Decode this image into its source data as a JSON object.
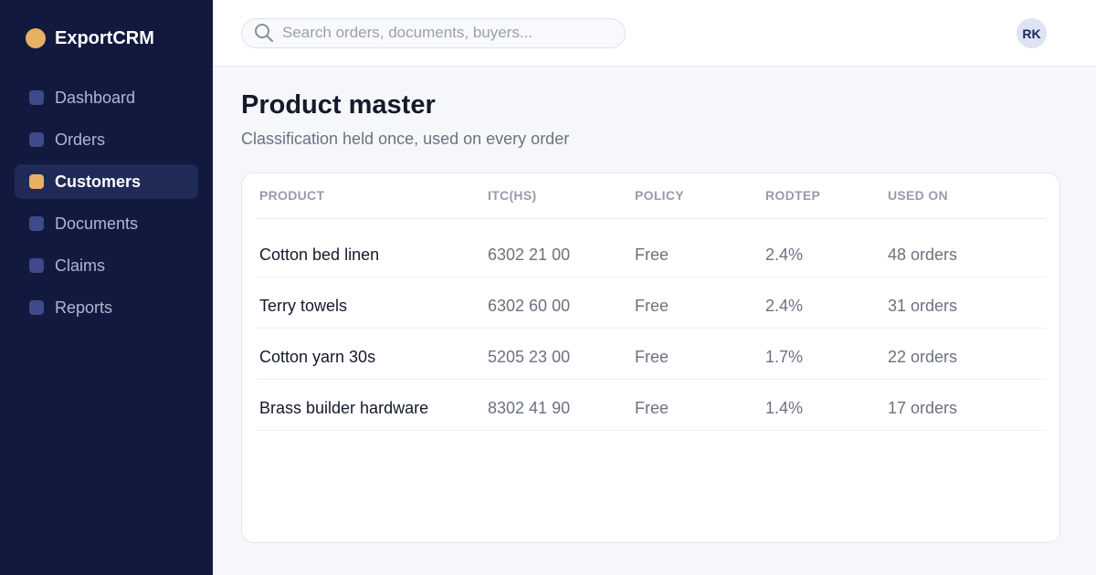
{
  "brand": {
    "name": "ExportCRM"
  },
  "sidebar": {
    "items": [
      {
        "label": "Dashboard",
        "active": false
      },
      {
        "label": "Orders",
        "active": false
      },
      {
        "label": "Customers",
        "active": true
      },
      {
        "label": "Documents",
        "active": false
      },
      {
        "label": "Claims",
        "active": false
      },
      {
        "label": "Reports",
        "active": false
      }
    ]
  },
  "topbar": {
    "search_placeholder": "Search orders, documents, buyers...",
    "avatar_initials": "RK"
  },
  "page": {
    "title": "Product master",
    "subtitle": "Classification held once, used on every order"
  },
  "table": {
    "headers": [
      "PRODUCT",
      "ITC(HS)",
      "POLICY",
      "RODTEP",
      "USED ON"
    ],
    "rows": [
      [
        "Cotton bed linen",
        "6302 21 00",
        "Free",
        "2.4%",
        "48 orders"
      ],
      [
        "Terry towels",
        "6302 60 00",
        "Free",
        "2.4%",
        "31 orders"
      ],
      [
        "Cotton yarn 30s",
        "5205 23 00",
        "Free",
        "1.7%",
        "22 orders"
      ],
      [
        "Brass builder hardware",
        "8302 41 90",
        "Free",
        "1.4%",
        "17 orders"
      ]
    ]
  },
  "colors": {
    "sidebar_bg": "#111a3e",
    "accent": "#e7b062",
    "nav_dot": "#3e4a8a"
  },
  "icons": {
    "brand": "brand-logo",
    "search": "search-icon"
  }
}
